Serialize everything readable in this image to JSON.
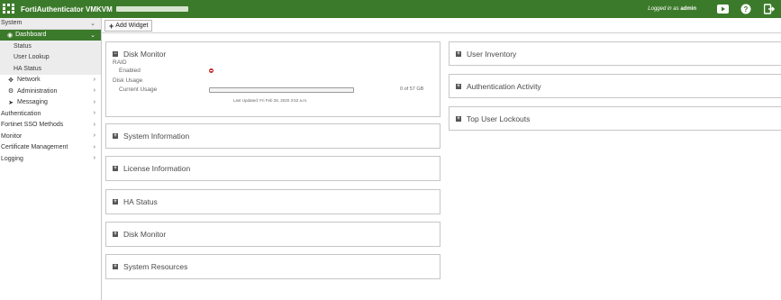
{
  "header": {
    "app_title": "FortiAuthenticator VMKVM",
    "logged_in_prefix": "Logged in as",
    "username": "admin",
    "brand_color": "#3c7a2b",
    "icons": [
      "fortinet-logo-icon",
      "video-play-icon",
      "help-icon",
      "logout-icon"
    ]
  },
  "sidebar": {
    "system": "System",
    "dashboard": "Dashboard",
    "dashboard_items": [
      "Status",
      "User Lookup",
      "HA Status"
    ],
    "system_items": [
      {
        "label": "Network",
        "icon": "network-icon"
      },
      {
        "label": "Administration",
        "icon": "gear-icon"
      },
      {
        "label": "Messaging",
        "icon": "send-icon"
      }
    ],
    "sections": [
      "Authentication",
      "Fortinet SSO Methods",
      "Monitor",
      "Certificate Management",
      "Logging"
    ]
  },
  "toolbar": {
    "add_widget": "Add Widget"
  },
  "disk_monitor": {
    "title": "Disk Monitor",
    "raid_label": "RAID",
    "enabled_label": "Enabled",
    "enabled_status": "disabled",
    "disk_usage_label": "Disk Usage",
    "current_usage_label": "Current Usage",
    "usage_text": "0 of 57 GB",
    "usage_fraction": 0,
    "last_updated": "Last Updated: Fri Feb 28, 2020 3:52 a.m."
  },
  "widgets_left": [
    "System Information",
    "License Information",
    "HA Status",
    "Disk Monitor",
    "System Resources"
  ],
  "widgets_right": [
    "User Inventory",
    "Authentication Activity",
    "Top User Lockouts"
  ]
}
